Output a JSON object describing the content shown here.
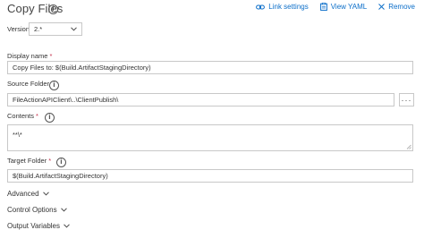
{
  "header": {
    "title": "Copy Files",
    "link_settings": "Link settings",
    "view_yaml": "View YAML",
    "remove": "Remove"
  },
  "version": {
    "label": "Version",
    "value": "2.*"
  },
  "display_name": {
    "label": "Display name",
    "value": "Copy Files to: $(Build.ArtifactStagingDirectory)"
  },
  "source_folder": {
    "label": "Source Folder",
    "value": "FileActionAPIClient\\..\\ClientPublish\\",
    "browse": "···"
  },
  "contents": {
    "label": "Contents",
    "value": "**\\*"
  },
  "target_folder": {
    "label": "Target Folder",
    "value": "$(Build.ArtifactStagingDirectory)"
  },
  "sections": {
    "advanced": "Advanced",
    "control_options": "Control Options",
    "output_variables": "Output Variables"
  },
  "colors": {
    "link": "#0b6ec9",
    "required": "#c4314b",
    "border": "#c8c8c8"
  }
}
